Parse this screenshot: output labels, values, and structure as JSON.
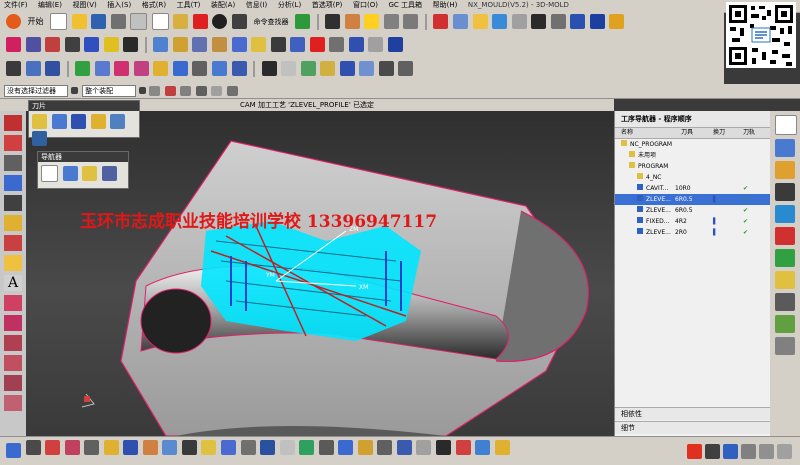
{
  "menu": [
    "文件(F)",
    "编辑(E)",
    "视图(V)",
    "插入(S)",
    "格式(R)",
    "工具(T)",
    "装配(A)",
    "信息(I)",
    "分析(L)",
    "首选项(P)",
    "窗口(O)",
    "GC 工具箱",
    "帮助(H)"
  ],
  "window_title": "NX_MOULD(V5.2) - 3D-MOLD",
  "toolbar": {
    "start_label": "开始",
    "command_finder_label": "命令查找器"
  },
  "filter": {
    "type_filter_value": "没有选择过滤器",
    "scope_value": "整个装配"
  },
  "graphics_title": "CAM 加工工艺 'ZLEVEL_PROFILE' 已选定",
  "panels": {
    "tool_panel_title": "刀片",
    "navigator_panel_title": "导航器"
  },
  "watermark": "玉环市志成职业技能培训学校  13396947117",
  "axis_labels": {
    "z": "ZM",
    "x": "XM",
    "y": "YM"
  },
  "navigator": {
    "title": "工序导航器 - 程序顺序",
    "columns": [
      "名称",
      "刀具",
      "换刀",
      "刀轨"
    ],
    "rows": [
      {
        "name": "NC_PROGRAM",
        "tool": "",
        "change": "",
        "path": "",
        "indent": 0
      },
      {
        "name": "未用项",
        "tool": "",
        "change": "",
        "path": "",
        "indent": 1
      },
      {
        "name": "PROGRAM",
        "tool": "",
        "change": "",
        "path": "",
        "indent": 1
      },
      {
        "name": "4_NC",
        "tool": "",
        "change": "",
        "path": "",
        "indent": 2
      },
      {
        "name": "CAVIT...",
        "tool": "10R0",
        "change": "",
        "path": "✔",
        "indent": 2
      },
      {
        "name": "ZLEVE...",
        "tool": "6R0.5",
        "change": "▌",
        "path": "✔",
        "indent": 2,
        "selected": true
      },
      {
        "name": "ZLEVE...",
        "tool": "6R0.5",
        "change": "",
        "path": "✔",
        "indent": 2
      },
      {
        "name": "FIXED...",
        "tool": "4R2",
        "change": "▌",
        "path": "✔",
        "indent": 2
      },
      {
        "name": "ZLEVE...",
        "tool": "2R0",
        "change": "▌",
        "path": "✔",
        "indent": 2
      }
    ],
    "section_dependencies": "相依性",
    "section_details": "细节"
  },
  "colors": {
    "accent_selected": "#3a6fd3",
    "watermark": "#e01818",
    "toolpath": "#00e5ff",
    "part_edge": "#e0206a"
  }
}
